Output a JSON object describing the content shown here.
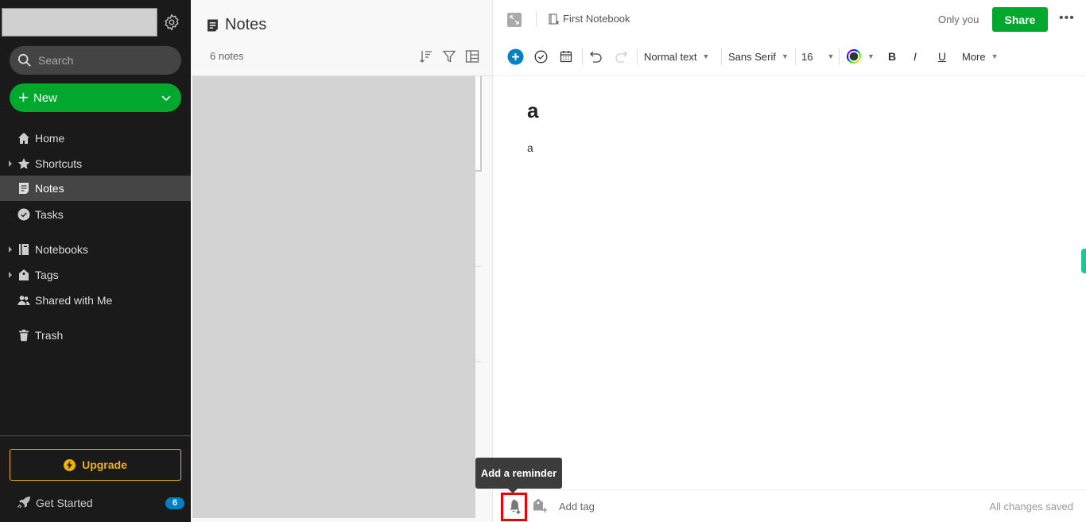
{
  "sidebar": {
    "search_placeholder": "Search",
    "new_label": "New",
    "items": [
      {
        "label": "Home",
        "icon": "home-icon",
        "expandable": false,
        "active": false
      },
      {
        "label": "Shortcuts",
        "icon": "star-icon",
        "expandable": true,
        "active": false
      },
      {
        "label": "Notes",
        "icon": "note-icon",
        "expandable": false,
        "active": true
      },
      {
        "label": "Tasks",
        "icon": "check-circle-icon",
        "expandable": false,
        "active": false
      },
      {
        "label": "Notebooks",
        "icon": "notebook-icon",
        "expandable": true,
        "active": false
      },
      {
        "label": "Tags",
        "icon": "tag-icon",
        "expandable": true,
        "active": false
      },
      {
        "label": "Shared with Me",
        "icon": "people-icon",
        "expandable": false,
        "active": false
      },
      {
        "label": "Trash",
        "icon": "trash-icon",
        "expandable": false,
        "active": false
      }
    ],
    "upgrade_label": "Upgrade",
    "get_started_label": "Get Started",
    "get_started_badge": "6",
    "colors": {
      "accent_green": "#00a82d",
      "upgrade_gold": "#f0b400",
      "badge_blue": "#0081c6"
    }
  },
  "notelist": {
    "title": "Notes",
    "count": "6 notes",
    "tools": [
      "sort-icon",
      "filter-icon",
      "view-icon"
    ]
  },
  "editor": {
    "notebook": "First Notebook",
    "visibility": "Only you",
    "share_label": "Share",
    "toolbar": {
      "style": "Normal text",
      "font": "Sans Serif",
      "size": "16",
      "more": "More"
    },
    "note_title": "a",
    "note_body": "a",
    "add_tag": "Add tag",
    "status": "All changes saved",
    "tooltip": "Add a reminder"
  }
}
